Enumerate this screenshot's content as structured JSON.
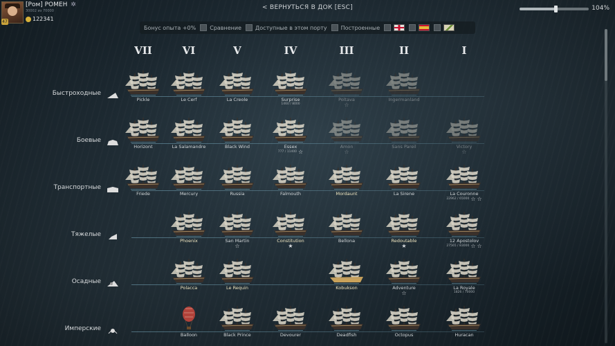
{
  "player": {
    "name": "[Ром] РОМЕН",
    "xp": "30002 из 70000",
    "gold": "122341",
    "rank": "47"
  },
  "nav": {
    "back_label": "< ВЕРНУТЬСЯ В ДОК [ESC]"
  },
  "zoom": {
    "value": 0.52,
    "label": "104%"
  },
  "filters": {
    "bonus": "Бонус опыта +0%",
    "compare": "Сравнение",
    "available": "Доступные в этом порту",
    "built": "Построенные"
  },
  "tiers": [
    "VII",
    "VI",
    "V",
    "IV",
    "III",
    "II",
    "I"
  ],
  "classes": [
    {
      "label": "Быстроходные",
      "ships": [
        {
          "name": "Pickle"
        },
        {
          "name": "Le Cerf"
        },
        {
          "name": "La Creole"
        },
        {
          "name": "Surprise",
          "xp": "1460 / 8000"
        },
        {
          "name": "Poltava",
          "dim": true,
          "star": true
        },
        {
          "name": "Ingermanland",
          "dim": true
        },
        null
      ]
    },
    {
      "label": "Боевые",
      "ships": [
        {
          "name": "Horizont"
        },
        {
          "name": "La Salamandre"
        },
        {
          "name": "Black Wind"
        },
        {
          "name": "Essex",
          "xp": "777 / 11400",
          "star": true
        },
        {
          "name": "Amon",
          "dim": true,
          "star": true
        },
        {
          "name": "Sans Pareil",
          "dim": true
        },
        {
          "name": "Victory",
          "dim": true,
          "star": true
        }
      ]
    },
    {
      "label": "Транспортные",
      "ships": [
        {
          "name": "Friede"
        },
        {
          "name": "Mercury"
        },
        {
          "name": "Russia"
        },
        {
          "name": "Falmouth"
        },
        {
          "name": "Mordaunt",
          "bold": true
        },
        {
          "name": "La Sirene"
        },
        {
          "name": "La Couronne",
          "xp": "22962 / 65000",
          "star": true,
          "star2": true
        }
      ]
    },
    {
      "label": "Тяжелые",
      "ships": [
        null,
        {
          "name": "Phoenix",
          "bold": true
        },
        {
          "name": "San Martin",
          "star": true
        },
        {
          "name": "Constitution",
          "star": true,
          "bold": true
        },
        {
          "name": "Bellona"
        },
        {
          "name": "Redoutable",
          "star": true,
          "bold": true
        },
        {
          "name": "12 Apostolov",
          "xp": "27565 / 83000",
          "star": true,
          "star2": true
        }
      ]
    },
    {
      "label": "Осадные",
      "ships": [
        null,
        {
          "name": "Polacca",
          "bold": true
        },
        {
          "name": "Le Requin",
          "bold": true
        },
        null,
        {
          "name": "Kobukson",
          "bold": true
        },
        {
          "name": "Adventure",
          "star": true
        },
        {
          "name": "La Royale",
          "xp": "1826 / 70000"
        }
      ]
    },
    {
      "label": "Имперские",
      "ships": [
        null,
        {
          "name": "Balloon",
          "balloon": true
        },
        {
          "name": "Black Prince"
        },
        {
          "name": "Devourer"
        },
        {
          "name": "Deadfish"
        },
        {
          "name": "Octopus"
        },
        {
          "name": "Huracan"
        }
      ]
    }
  ],
  "colors": {
    "accent_line": "#78aabe",
    "text": "#d4d8da",
    "dim_text": "#7c8489",
    "gold": "#d8b23a"
  }
}
